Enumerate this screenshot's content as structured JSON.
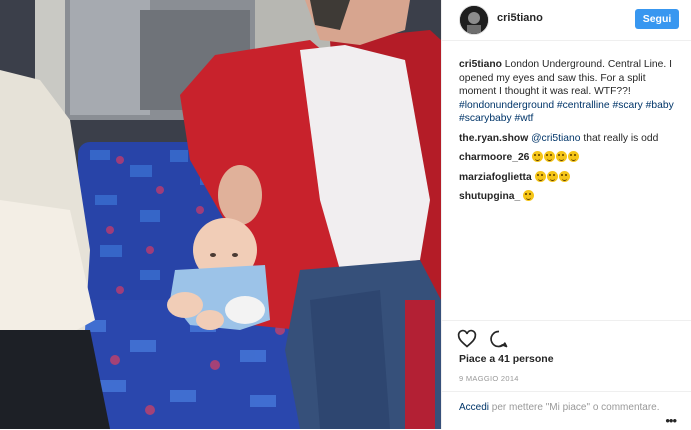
{
  "header": {
    "username": "cri5tiano",
    "follow_label": "Segui"
  },
  "caption": {
    "author": "cri5tiano",
    "text": "London Underground. Central Line. I opened my eyes and saw this. For a split moment I thought it was real. WTF??!",
    "hashtags": [
      "#londonunderground",
      "#centralline",
      "#scary",
      "#baby",
      "#scarybaby",
      "#wtf"
    ]
  },
  "comments": [
    {
      "user": "the.ryan.show",
      "mention": "@cri5tiano",
      "text": "that really is odd",
      "emoji_count": 0
    },
    {
      "user": "charmoore_26",
      "mention": "",
      "text": "",
      "emoji_count": 4,
      "emoji": "crying-laughing-emoji"
    },
    {
      "user": "marziafoglietta",
      "mention": "",
      "text": "",
      "emoji_count": 3,
      "emoji": "smiling-emoji"
    },
    {
      "user": "shutupgina_",
      "mention": "",
      "text": "",
      "emoji_count": 1,
      "emoji": "screaming-emoji"
    }
  ],
  "actions": {
    "like_icon": "heart-icon",
    "comment_icon": "comment-bubble-icon",
    "likes_text": "Piace a 41 persone",
    "date": "9 MAGGIO 2014"
  },
  "login_prompt": {
    "link": "Accedi",
    "rest": " per mettere \"Mi piace\" o commentare."
  },
  "more_label": "•••"
}
